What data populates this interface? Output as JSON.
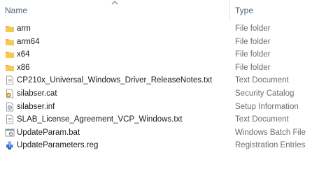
{
  "header": {
    "name_label": "Name",
    "type_label": "Type",
    "sort_indicator": "chevron-up-icon"
  },
  "rows": [
    {
      "name": "arm",
      "type": "File folder",
      "icon": "folder-icon"
    },
    {
      "name": "arm64",
      "type": "File folder",
      "icon": "folder-icon"
    },
    {
      "name": "x64",
      "type": "File folder",
      "icon": "folder-icon"
    },
    {
      "name": "x86",
      "type": "File folder",
      "icon": "folder-icon"
    },
    {
      "name": "CP210x_Universal_Windows_Driver_ReleaseNotes.txt",
      "type": "Text Document",
      "icon": "text-document-icon"
    },
    {
      "name": "silabser.cat",
      "type": "Security Catalog",
      "icon": "security-catalog-icon"
    },
    {
      "name": "silabser.inf",
      "type": "Setup Information",
      "icon": "setup-information-icon"
    },
    {
      "name": "SLAB_License_Agreement_VCP_Windows.txt",
      "type": "Text Document",
      "icon": "text-document-icon"
    },
    {
      "name": "UpdateParam.bat",
      "type": "Windows Batch File",
      "icon": "batch-file-icon"
    },
    {
      "name": "UpdateParameters.reg",
      "type": "Registration Entries",
      "icon": "registry-icon"
    }
  ],
  "colors": {
    "folder": "#e8b33a",
    "header_text": "#4c607a",
    "type_text": "#6d6d6d"
  }
}
